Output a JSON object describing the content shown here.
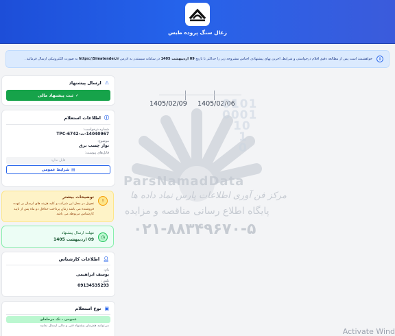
{
  "header": {
    "title": "زغال سنگ پروده طبس"
  },
  "notice": {
    "text_a": "خواهشمند است پس از مطالعه دقیق اقلام درخواستی و شرایط، آخرین بهای پیشنهادی اجناس مشروحه زیر را حداکثر تا تاریخ ",
    "deadline": "09 اردیبهشت 1405",
    "text_b": " در سامانه سیمتندر به آدرس ",
    "url": "https://Simatender.ir",
    "text_c": " به صورت الکترونیکی ارسال فرمائید ."
  },
  "submit_card": {
    "title": "ارسال پیشنهاد",
    "button": "ثبت پیشنهاد مالی"
  },
  "inquiry_card": {
    "title": "اطلاعات استعلام",
    "request_no_label": "شماره درخواست:",
    "request_no": "14040967-ت-TPC-6742",
    "subject_label": "موضوع:",
    "subject": "نوار چسب برق",
    "files_label": "فایل‌های پیوست:",
    "no_file": "فایل ندارد",
    "terms_button": "شرایط عمومی"
  },
  "notes_card": {
    "title": "توضیحات بیشتر",
    "text": "تحویل در محل این شرکت و کلیه هزینه های ارسال بر عهده فروشنده می باشد زمان پرداخت حداقل دو ماه پس از تایید کارشناس مربوطه می باشد"
  },
  "deadline_card": {
    "label": "مهلت ارسال پیشنهاد",
    "value": "09 اردیبهشت 1405"
  },
  "expert_card": {
    "title": "اطلاعات کارشناس",
    "name_label": "نام:",
    "name": "یوسف ابراهیمی",
    "phone_label": "تلفن:",
    "phone": "09134535293"
  },
  "type_card": {
    "title": "نوع استعلام",
    "badge": "عمومی - تک مرحله‌ای",
    "desc": "می‌توانید همزمان پیشنهاد فنی و مالی ارسال نمایید"
  },
  "dates": {
    "start": "1405/02/06",
    "end": "1405/02/09"
  },
  "watermark": {
    "digits": [
      "0101",
      "0001",
      "10",
      "1",
      "0"
    ],
    "brand": "ParsNamadData",
    "line1": "مرکز فن آوری اطلاعات پارس نماد داده ها",
    "line2": "پایگاه اطلاع رسانی مناقصه و مزایده",
    "phone": "۰۲۱-۸۸۳۴۹۶۷۰-۵"
  },
  "os_overlay": {
    "text": "Activate Wind"
  },
  "colors": {
    "header": "#2563eb",
    "accent_green": "#16a34a",
    "notice_bg": "#dbeafe"
  }
}
